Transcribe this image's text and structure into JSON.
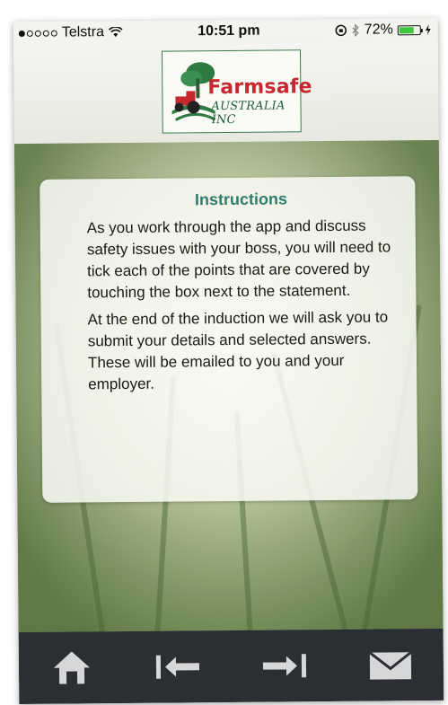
{
  "status_bar": {
    "carrier": "Telstra",
    "time": "10:51 pm",
    "battery_percent": "72%",
    "battery_level": 0.72,
    "signal_bars": 1,
    "icons": [
      "signal-dots-icon",
      "wifi-icon",
      "orientation-lock-icon",
      "bluetooth-icon",
      "battery-icon",
      "charging-icon"
    ]
  },
  "logo": {
    "name": "Farmsafe",
    "subtitle": "AUSTRALIA INC",
    "icon": "tractor-tree-icon",
    "colors": {
      "name": "#c7272e",
      "subtitle": "#1f5d35",
      "border": "#3a7a4a"
    }
  },
  "instructions": {
    "title": "Instructions",
    "paragraph1": "As you work through the app and discuss safety issues with your boss, you will need to tick each of the points that are covered by touching the box next to the statement.",
    "paragraph2": "At the end of the induction we will ask you to submit your details and selected answers. These will be emailed to you and your employer."
  },
  "tab_bar": {
    "items": [
      {
        "name": "home",
        "icon": "home-icon"
      },
      {
        "name": "previous",
        "icon": "arrow-to-start-icon"
      },
      {
        "name": "next",
        "icon": "arrow-to-end-icon"
      },
      {
        "name": "mail",
        "icon": "envelope-icon"
      }
    ],
    "icon_color": "#d7d7d7",
    "background": "#2b2f33"
  },
  "colors": {
    "title_accent": "#2f7d6d"
  }
}
